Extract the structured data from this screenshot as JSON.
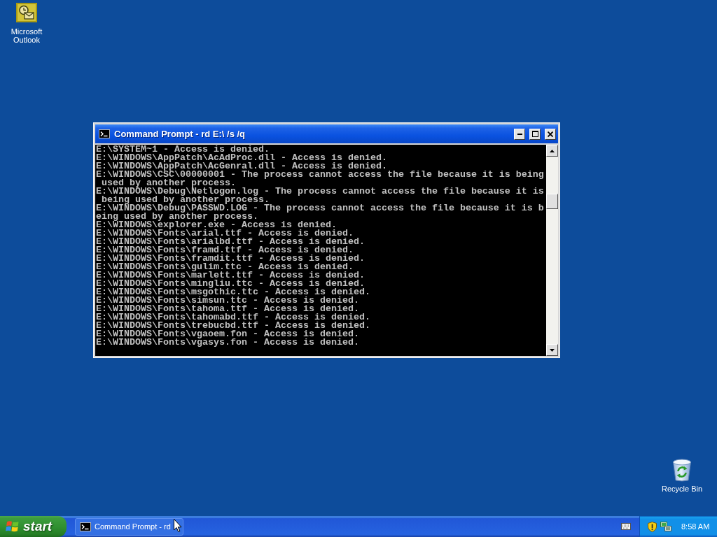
{
  "desktop_icons": [
    {
      "kind": "outlook",
      "label": "Microsoft Outlook"
    },
    {
      "kind": "recycle_bin",
      "label": "Recycle Bin"
    }
  ],
  "window": {
    "title": "Command Prompt - rd E:\\ /s /q",
    "console_lines": [
      "E:\\SYSTEM~1 - Access is denied.",
      "E:\\WINDOWS\\AppPatch\\AcAdProc.dll - Access is denied.",
      "E:\\WINDOWS\\AppPatch\\AcGenral.dll - Access is denied.",
      "E:\\WINDOWS\\CSC\\00000001 - The process cannot access the file because it is being",
      " used by another process.",
      "E:\\WINDOWS\\Debug\\Netlogon.log - The process cannot access the file because it is",
      " being used by another process.",
      "E:\\WINDOWS\\Debug\\PASSWD.LOG - The process cannot access the file because it is b",
      "eing used by another process.",
      "E:\\WINDOWS\\explorer.exe - Access is denied.",
      "E:\\WINDOWS\\Fonts\\arial.ttf - Access is denied.",
      "E:\\WINDOWS\\Fonts\\arialbd.ttf - Access is denied.",
      "E:\\WINDOWS\\Fonts\\framd.ttf - Access is denied.",
      "E:\\WINDOWS\\Fonts\\framdit.ttf - Access is denied.",
      "E:\\WINDOWS\\Fonts\\gulim.ttc - Access is denied.",
      "E:\\WINDOWS\\Fonts\\marlett.ttf - Access is denied.",
      "E:\\WINDOWS\\Fonts\\mingliu.ttc - Access is denied.",
      "E:\\WINDOWS\\Fonts\\msgothic.ttc - Access is denied.",
      "E:\\WINDOWS\\Fonts\\simsun.ttc - Access is denied.",
      "E:\\WINDOWS\\Fonts\\tahoma.ttf - Access is denied.",
      "E:\\WINDOWS\\Fonts\\tahomabd.ttf - Access is denied.",
      "E:\\WINDOWS\\Fonts\\trebucbd.ttf - Access is denied.",
      "E:\\WINDOWS\\Fonts\\vgaoem.fon - Access is denied.",
      "E:\\WINDOWS\\Fonts\\vgasys.fon - Access is denied."
    ]
  },
  "taskbar": {
    "start_button": "start",
    "tasks": [
      {
        "label": "Command Prompt - rd"
      }
    ],
    "clock": "8:58 AM"
  }
}
